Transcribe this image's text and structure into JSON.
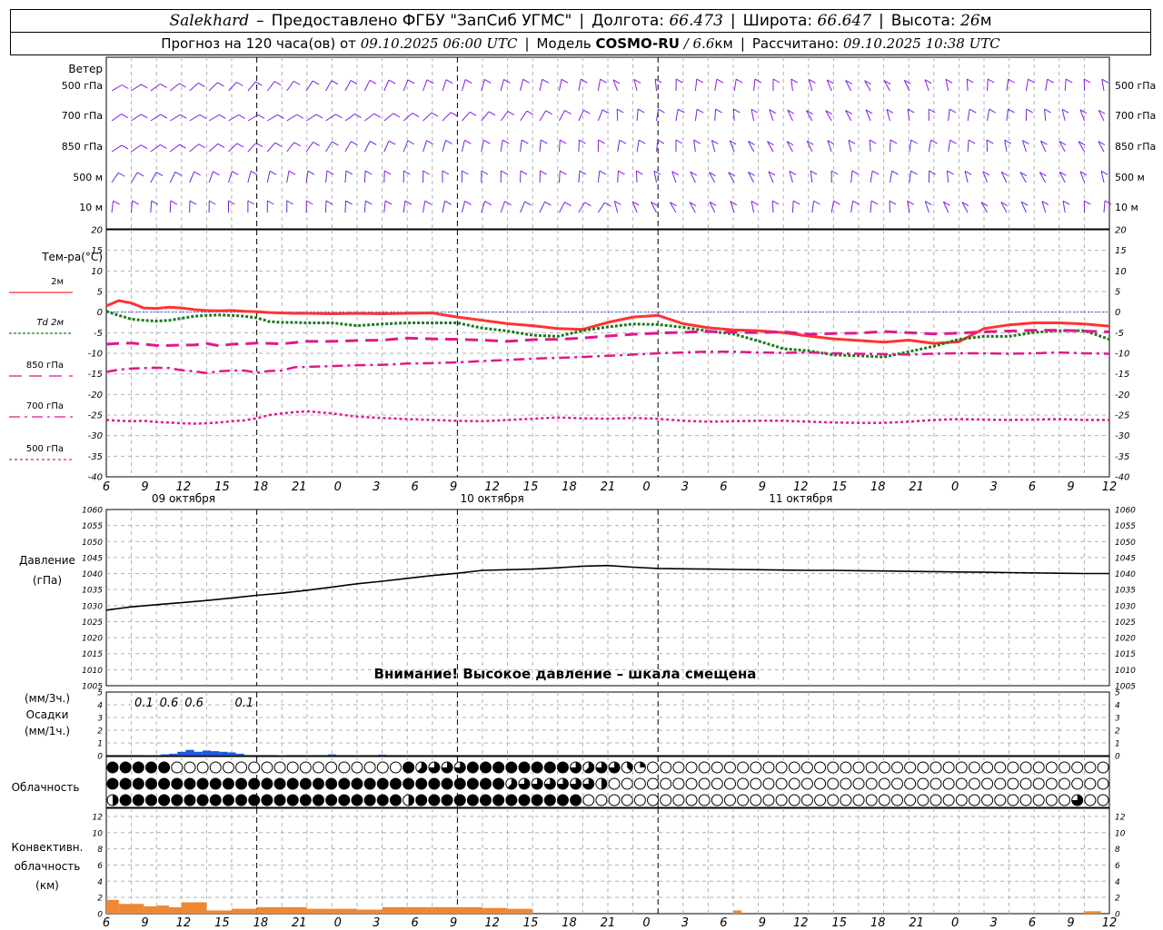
{
  "header": {
    "station": "Salekhard",
    "dash": "–",
    "provider": "Предоставлено ФГБУ \"ЗапСиб УГМС\"",
    "lon_label": "Долгота:",
    "lon_value": "66.473",
    "lat_label": "Широта:",
    "lat_value": "66.647",
    "alt_label": "Высота:",
    "alt_value": "26",
    "alt_unit": "м",
    "forecast_label": "Прогноз на 120 часа(ов) от",
    "forecast_start": "09.10.2025 06:00 UTC",
    "model_label": "Модель",
    "model_name": "COSMO-RU",
    "model_res": "/ 6.6",
    "model_res_unit": "км",
    "calc_label": "Рассчитано:",
    "calc_time": "09.10.2025 10:38 UTC"
  },
  "time_axis": {
    "tick_labels": [
      "6",
      "9",
      "12",
      "15",
      "18",
      "21",
      "0",
      "3",
      "6",
      "9",
      "12",
      "15",
      "18",
      "21",
      "0",
      "3",
      "6",
      "9",
      "12",
      "15",
      "18",
      "21",
      "0",
      "3",
      "6",
      "9",
      "12"
    ],
    "day_labels": [
      {
        "text": "09 октября",
        "tick": 2
      },
      {
        "text": "10 октября",
        "tick": 10
      },
      {
        "text": "11 октября",
        "tick": 18
      }
    ],
    "day_lines": [
      6,
      14,
      22
    ]
  },
  "wind_panel": {
    "title": "Ветер",
    "levels": [
      "500 гПа",
      "700 гПа",
      "850 гПа",
      "500 м",
      "10 м"
    ],
    "color": "#7b1fe0"
  },
  "chart_data": [
    {
      "type": "line",
      "name": "temperature",
      "ylabel": "Тем-ра(°С)",
      "ylim": [
        -40,
        20
      ],
      "yticks": [
        -40,
        -35,
        -30,
        -25,
        -20,
        -15,
        -10,
        -5,
        0,
        5,
        10,
        15,
        20
      ],
      "x_hours": [
        0,
        1.5,
        3,
        4.5,
        6,
        7.5,
        9,
        10.5,
        12,
        13.5,
        15,
        16.5,
        18,
        19.5,
        21,
        22.5,
        24,
        27,
        30,
        33,
        36,
        39,
        42,
        45,
        48,
        51,
        54,
        57,
        60,
        63,
        66,
        69,
        72,
        75,
        78,
        81,
        84,
        87,
        90,
        93,
        96,
        99,
        102,
        105,
        108,
        111,
        114,
        117,
        120
      ],
      "series": [
        {
          "name": "2м",
          "color": "#ff3333",
          "values": [
            1.5,
            2.8,
            2.2,
            1.0,
            0.9,
            1.2,
            1.0,
            0.6,
            0.4,
            0.3,
            0.4,
            0.2,
            0.1,
            -0.1,
            -0.2,
            -0.3,
            -0.3,
            -0.4,
            -0.3,
            -0.4,
            -0.3,
            -0.2,
            -1.2,
            -2.0,
            -2.8,
            -3.3,
            -4.0,
            -4.2,
            -2.5,
            -1.2,
            -0.8,
            -2.8,
            -3.8,
            -4.3,
            -4.5,
            -5.0,
            -5.8,
            -6.5,
            -6.9,
            -7.3,
            -6.8,
            -7.6,
            -7.2,
            -4.0,
            -3.1,
            -2.6,
            -2.6,
            -2.9,
            -3.4
          ]
        },
        {
          "name": "Td 2м",
          "color": "#1a7a1a",
          "values": [
            0.2,
            -0.8,
            -1.7,
            -2.0,
            -2.2,
            -2.0,
            -1.5,
            -1.0,
            -0.8,
            -0.7,
            -0.8,
            -1.0,
            -1.4,
            -2.3,
            -2.5,
            -2.5,
            -2.6,
            -2.6,
            -3.3,
            -2.9,
            -2.6,
            -2.6,
            -2.6,
            -3.9,
            -4.6,
            -5.6,
            -5.9,
            -4.5,
            -3.6,
            -2.9,
            -3.0,
            -3.7,
            -4.6,
            -5.3,
            -7.0,
            -8.9,
            -9.4,
            -10.4,
            -10.6,
            -10.9,
            -9.6,
            -8.3,
            -6.6,
            -5.9,
            -5.9,
            -4.9,
            -4.5,
            -4.5,
            -6.6
          ]
        },
        {
          "name": "850 гПа",
          "color": "#e0188c",
          "values": [
            -7.8,
            -7.6,
            -7.5,
            -7.8,
            -8.1,
            -8.1,
            -8.0,
            -8.0,
            -7.6,
            -8.2,
            -7.8,
            -7.7,
            -7.5,
            -7.6,
            -7.7,
            -7.4,
            -7.1,
            -7.1,
            -6.9,
            -6.8,
            -6.3,
            -6.5,
            -6.6,
            -6.8,
            -7.1,
            -6.7,
            -6.6,
            -6.3,
            -5.8,
            -5.4,
            -5.1,
            -4.9,
            -4.7,
            -4.9,
            -5.0,
            -4.8,
            -5.4,
            -5.2,
            -5.1,
            -4.7,
            -5.0,
            -5.3,
            -5.1,
            -4.8,
            -4.6,
            -4.4,
            -4.4,
            -4.6,
            -4.8
          ]
        },
        {
          "name": "700 гПа",
          "color": "#e0188c",
          "values": [
            -14.5,
            -14.0,
            -13.7,
            -13.6,
            -13.5,
            -13.6,
            -14.1,
            -14.4,
            -14.8,
            -14.4,
            -14.2,
            -14.2,
            -14.7,
            -14.3,
            -14.2,
            -13.4,
            -13.3,
            -13.1,
            -12.9,
            -12.8,
            -12.5,
            -12.4,
            -12.2,
            -11.9,
            -11.6,
            -11.3,
            -11.1,
            -10.9,
            -10.6,
            -10.3,
            -10.0,
            -9.8,
            -9.6,
            -9.6,
            -9.8,
            -9.9,
            -9.8,
            -10.0,
            -10.1,
            -10.2,
            -10.3,
            -10.1,
            -10.0,
            -10.0,
            -10.1,
            -10.0,
            -9.8,
            -10.0,
            -10.1
          ]
        },
        {
          "name": "500 гПа",
          "color": "#e0188c",
          "values": [
            -26.2,
            -26.4,
            -26.5,
            -26.4,
            -26.7,
            -26.8,
            -27.0,
            -27.1,
            -27.0,
            -26.8,
            -26.5,
            -26.3,
            -25.8,
            -25.0,
            -24.6,
            -24.3,
            -24.1,
            -24.6,
            -25.4,
            -25.7,
            -26.0,
            -26.2,
            -26.4,
            -26.5,
            -26.2,
            -25.9,
            -25.6,
            -25.8,
            -25.9,
            -25.7,
            -25.9,
            -26.4,
            -26.6,
            -26.5,
            -26.4,
            -26.4,
            -26.6,
            -26.8,
            -26.9,
            -26.9,
            -26.6,
            -26.2,
            -26.0,
            -26.1,
            -26.2,
            -26.1,
            -26.0,
            -26.2,
            -26.2
          ]
        }
      ]
    },
    {
      "type": "line",
      "name": "pressure",
      "ylabel": "Давление",
      "ylabel_unit": "(гПа)",
      "ylim": [
        1005,
        1060
      ],
      "yticks": [
        1005,
        1010,
        1015,
        1020,
        1025,
        1030,
        1035,
        1040,
        1045,
        1050,
        1055,
        1060
      ],
      "x_hours": [
        0,
        3,
        6,
        9,
        12,
        15,
        18,
        21,
        24,
        27,
        30,
        33,
        36,
        39,
        42,
        45,
        48,
        51,
        54,
        57,
        60,
        63,
        66,
        69,
        72,
        75,
        78,
        81,
        84,
        87,
        90,
        93,
        96,
        99,
        102,
        105,
        108,
        111,
        114,
        117,
        120
      ],
      "series": [
        {
          "name": "pressure",
          "color": "#000000",
          "values": [
            1028.6,
            1029.6,
            1030.3,
            1030.9,
            1031.6,
            1032.4,
            1033.2,
            1033.9,
            1034.8,
            1035.8,
            1036.8,
            1037.6,
            1038.5,
            1039.4,
            1040.1,
            1041.0,
            1041.2,
            1041.4,
            1041.8,
            1042.3,
            1042.5,
            1042.0,
            1041.6,
            1041.5,
            1041.4,
            1041.3,
            1041.2,
            1041.1,
            1041.0,
            1041.0,
            1040.9,
            1040.8,
            1040.7,
            1040.6,
            1040.5,
            1040.4,
            1040.3,
            1040.2,
            1040.1,
            1040.0,
            1040.0
          ]
        }
      ],
      "warning": "Внимание! Высокое давление – шкала смещена"
    },
    {
      "type": "bar",
      "name": "precipitation",
      "ylabel_lines": [
        "(мм/3ч.)",
        "Осадки",
        "(мм/1ч.)"
      ],
      "ylim": [
        0,
        5
      ],
      "yticks": [
        0,
        1,
        2,
        3,
        4,
        5
      ],
      "x_hours": [
        5,
        6,
        7,
        8,
        9,
        10,
        11,
        12,
        13,
        14,
        15,
        16,
        18,
        21,
        24,
        27,
        30,
        33,
        36
      ],
      "values": [
        0.02,
        0.05,
        0.1,
        0.15,
        0.3,
        0.45,
        0.3,
        0.4,
        0.35,
        0.3,
        0.25,
        0.15,
        0.05,
        0.03,
        0.05,
        0.1,
        0.05,
        0.08,
        0.05
      ],
      "annotations": [
        {
          "text": "0.1",
          "hour": 4.5
        },
        {
          "text": "0.6",
          "hour": 7.5
        },
        {
          "text": "0.6",
          "hour": 10.5
        },
        {
          "text": "0.1",
          "hour": 16.5
        }
      ],
      "color": "#2255dd"
    },
    {
      "type": "table",
      "name": "cloudiness",
      "ylabel": "Облачность",
      "rows": [
        "888880000000000000000008566688888888656632000000000000000000000000000000000000",
        "888888888888888888888888888888856666664000000000000000000000000000000000000000",
        "488888888888888888888884888888888888800000000000000000000000000000000000000600"
      ]
    },
    {
      "type": "bar",
      "name": "convective",
      "ylabel_lines": [
        "Конвективн.",
        "облачность",
        "(км)"
      ],
      "ylim": [
        0,
        13
      ],
      "yticks": [
        0,
        2,
        4,
        6,
        8,
        10,
        12
      ],
      "segments": [
        {
          "x0": 0,
          "x1": 1.5,
          "v": 1.7
        },
        {
          "x0": 1.5,
          "x1": 4.5,
          "v": 1.2
        },
        {
          "x0": 4.5,
          "x1": 6,
          "v": 0.9
        },
        {
          "x0": 6,
          "x1": 7.5,
          "v": 1.0
        },
        {
          "x0": 7.5,
          "x1": 9,
          "v": 0.8
        },
        {
          "x0": 9,
          "x1": 12,
          "v": 1.4
        },
        {
          "x0": 12,
          "x1": 15,
          "v": 0.4
        },
        {
          "x0": 15,
          "x1": 18,
          "v": 0.6
        },
        {
          "x0": 18,
          "x1": 24,
          "v": 0.8
        },
        {
          "x0": 24,
          "x1": 30,
          "v": 0.6
        },
        {
          "x0": 30,
          "x1": 33,
          "v": 0.5
        },
        {
          "x0": 33,
          "x1": 39,
          "v": 0.8
        },
        {
          "x0": 39,
          "x1": 45,
          "v": 0.8
        },
        {
          "x0": 45,
          "x1": 48,
          "v": 0.7
        },
        {
          "x0": 48,
          "x1": 51,
          "v": 0.6
        },
        {
          "x0": 75,
          "x1": 76,
          "v": 0.4
        },
        {
          "x0": 117,
          "x1": 119,
          "v": 0.3
        }
      ],
      "color": "#ee8833"
    }
  ]
}
